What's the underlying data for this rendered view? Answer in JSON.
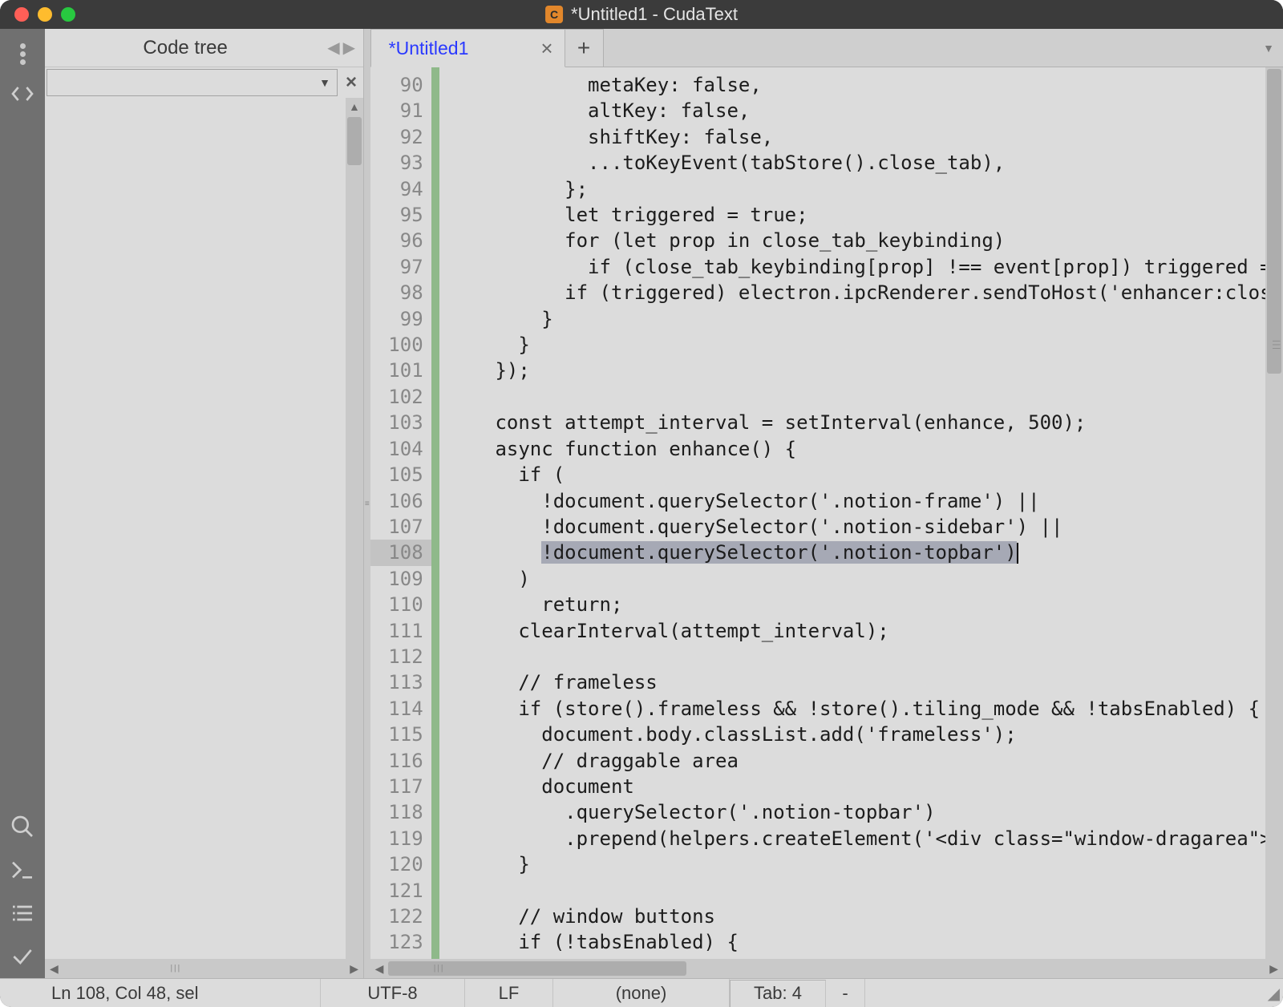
{
  "window": {
    "title": "*Untitled1 - CudaText"
  },
  "sidebar": {
    "title": "Code tree"
  },
  "tabs": {
    "active": "*Untitled1"
  },
  "gutter": [
    "90",
    "91",
    "92",
    "93",
    "94",
    "95",
    "96",
    "97",
    "98",
    "99",
    "100",
    "101",
    "102",
    "103",
    "104",
    "105",
    "106",
    "107",
    "108",
    "109",
    "110",
    "111",
    "112",
    "113",
    "114",
    "115",
    "116",
    "117",
    "118",
    "119",
    "120",
    "121",
    "122",
    "123"
  ],
  "current_line_index": 18,
  "code": {
    "l90": "            metaKey: false,",
    "l91": "            altKey: false,",
    "l92": "            shiftKey: false,",
    "l93": "            ...toKeyEvent(tabStore().close_tab),",
    "l94": "          };",
    "l95": "          let triggered = true;",
    "l96": "          for (let prop in close_tab_keybinding)",
    "l97": "            if (close_tab_keybinding[prop] !== event[prop]) triggered = ",
    "l98": "          if (triggered) electron.ipcRenderer.sendToHost('enhancer:close",
    "l99": "        }",
    "l100": "      }",
    "l101": "    });",
    "l102": "",
    "l103": "    const attempt_interval = setInterval(enhance, 500);",
    "l104": "    async function enhance() {",
    "l105": "      if (",
    "l106": "        !document.querySelector('.notion-frame') ||",
    "l107": "        !document.querySelector('.notion-sidebar') ||",
    "l108a": "        ",
    "l108b": "!document.querySelector('.notion-topbar')",
    "l109": "      )",
    "l110": "        return;",
    "l111": "      clearInterval(attempt_interval);",
    "l112": "",
    "l113": "      // frameless",
    "l114": "      if (store().frameless && !store().tiling_mode && !tabsEnabled) {",
    "l115": "        document.body.classList.add('frameless');",
    "l116": "        // draggable area",
    "l117": "        document",
    "l118": "          .querySelector('.notion-topbar')",
    "l119": "          .prepend(helpers.createElement('<div class=\"window-dragarea\"><",
    "l120": "      }",
    "l121": "",
    "l122": "      // window buttons",
    "l123": "      if (!tabsEnabled) {"
  },
  "status": {
    "pos": "Ln 108, Col 48, sel",
    "encoding": "UTF-8",
    "line_ending": "LF",
    "lexer": "(none)",
    "tab": "Tab: 4",
    "dash": "-"
  }
}
